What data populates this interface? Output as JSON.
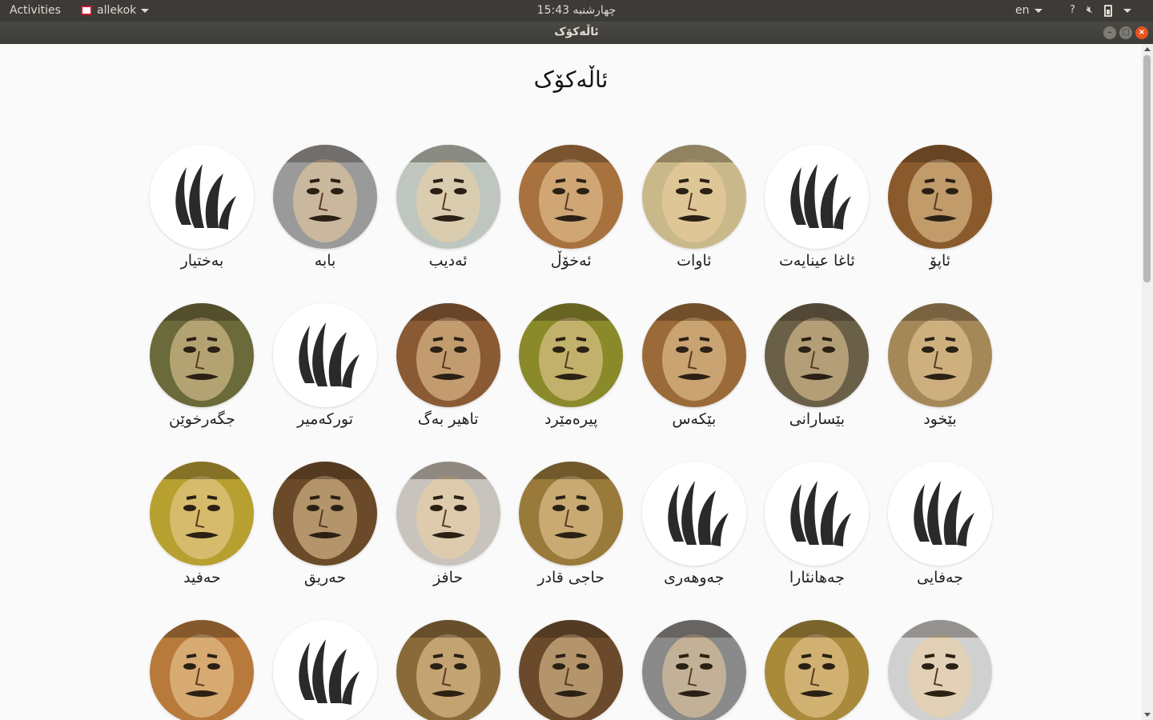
{
  "panel": {
    "activities": "Activities",
    "app_name": "allekok",
    "clock": "چهارشنبه 15:43",
    "lang": "en",
    "help_icon": "?"
  },
  "window": {
    "title": "ئاڵەکۆک"
  },
  "page": {
    "heading": "ئاڵەکۆک"
  },
  "poets": [
    {
      "name": "ئاپۆ",
      "img": "portrait",
      "tone": "#8a5a2c"
    },
    {
      "name": "ئاغا عینایەت",
      "img": "logo"
    },
    {
      "name": "ئاوات",
      "img": "portrait",
      "tone": "#c9b98a"
    },
    {
      "name": "ئەخۆڵ",
      "img": "portrait",
      "tone": "#a7723e"
    },
    {
      "name": "ئەدیب",
      "img": "portrait",
      "tone": "#bfc6bf"
    },
    {
      "name": "بابە",
      "img": "portrait",
      "tone": "#9a9a9a"
    },
    {
      "name": "بەختیار",
      "img": "logo"
    },
    {
      "name": "بێخود",
      "img": "portrait",
      "tone": "#a48858"
    },
    {
      "name": "بێسارانی",
      "img": "portrait",
      "tone": "#6a6048"
    },
    {
      "name": "بێکەس",
      "img": "portrait",
      "tone": "#9a6a38"
    },
    {
      "name": "پیرەمێرد",
      "img": "portrait",
      "tone": "#8a8a2a"
    },
    {
      "name": "تاهیر بەگ",
      "img": "portrait",
      "tone": "#8a5a34"
    },
    {
      "name": "تورکەمیر",
      "img": "logo"
    },
    {
      "name": "جگەرخوێن",
      "img": "portrait",
      "tone": "#6a6a3a"
    },
    {
      "name": "جەفایی",
      "img": "logo"
    },
    {
      "name": "جەهانئارا",
      "img": "logo"
    },
    {
      "name": "جەوهەری",
      "img": "logo"
    },
    {
      "name": "حاجی قادر",
      "img": "portrait",
      "tone": "#9a7a3a"
    },
    {
      "name": "حافز",
      "img": "portrait",
      "tone": "#c8c4bd"
    },
    {
      "name": "حەریق",
      "img": "portrait",
      "tone": "#6a4a28"
    },
    {
      "name": "حەفید",
      "img": "portrait",
      "tone": "#b8a030"
    },
    {
      "name": "",
      "img": "portrait",
      "tone": "#d0d0d0"
    },
    {
      "name": "",
      "img": "portrait",
      "tone": "#a88a3a"
    },
    {
      "name": "",
      "img": "portrait",
      "tone": "#8a8a8a"
    },
    {
      "name": "",
      "img": "portrait",
      "tone": "#6a4a2a"
    },
    {
      "name": "",
      "img": "portrait",
      "tone": "#8a6a38"
    },
    {
      "name": "",
      "img": "logo"
    },
    {
      "name": "",
      "img": "portrait",
      "tone": "#b87a3a"
    }
  ]
}
